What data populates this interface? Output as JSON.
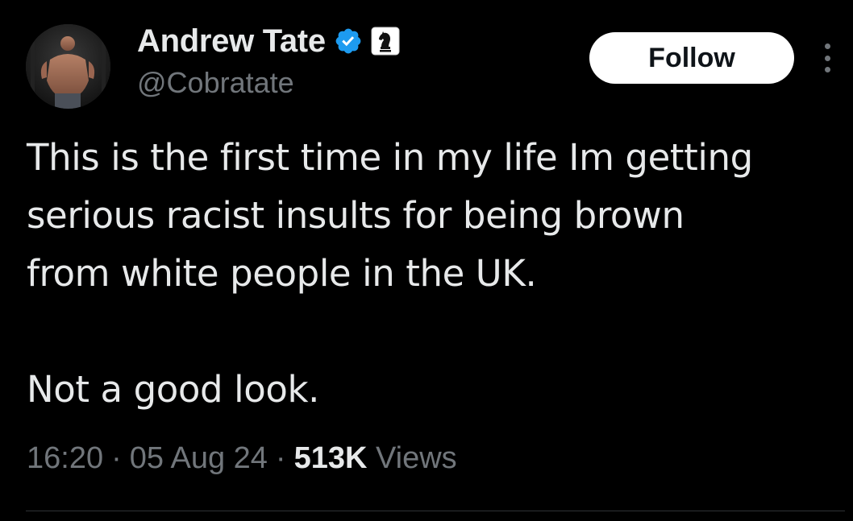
{
  "author": {
    "display_name": "Andrew Tate",
    "handle": "@Cobratate",
    "verified": true,
    "verified_color": "#1d9bf0",
    "affiliate_badge_icon": "chess-knight-icon"
  },
  "actions": {
    "follow_label": "Follow",
    "more_icon": "more-vertical-icon"
  },
  "tweet": {
    "lines": [
      "This is the first time in my life Im getting",
      "serious racist insults for being brown",
      "from white people in the UK.",
      "",
      "Not a good look."
    ]
  },
  "meta": {
    "time": "16:20",
    "separator": "·",
    "date": "05 Aug 24",
    "views_count": "513K",
    "views_label": "Views"
  },
  "colors": {
    "background": "#000000",
    "primary_text": "#e7e9ea",
    "secondary_text": "#71767b",
    "follow_bg": "#ffffff",
    "follow_text": "#0f1419"
  }
}
